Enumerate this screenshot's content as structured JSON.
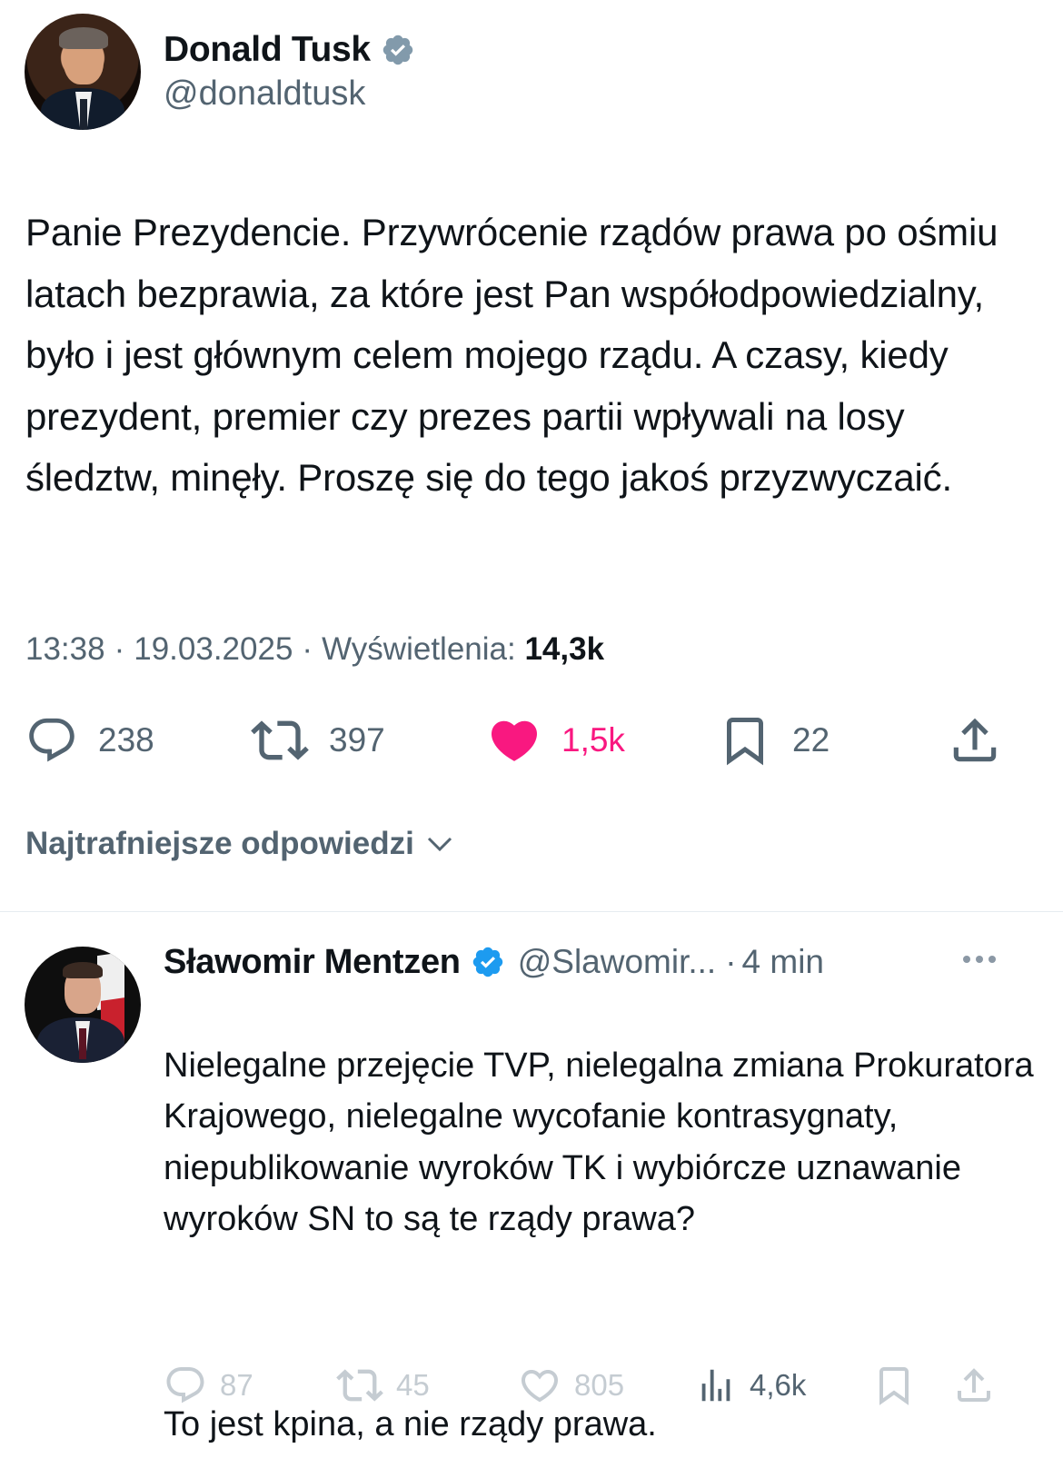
{
  "main_tweet": {
    "author": {
      "name": "Donald Tusk",
      "handle": "@donaldtusk",
      "verified": "gray"
    },
    "text": "Panie Prezydencie. Przywrócenie rządów prawa po ośmiu latach bezprawia, za które jest Pan współodpowiedzialny, było i jest głównym celem mojego rządu. A czasy, kiedy prezydent, premier czy prezes partii wpływali na losy śledztw, minęły. Proszę się do tego jakoś przyzwyczaić.",
    "time": "13:38",
    "date": "19.03.2025",
    "views_label": "Wyświetlenia:",
    "views_count": "14,3k",
    "separator": "·",
    "stats": {
      "replies": "238",
      "reposts": "397",
      "likes": "1,5k",
      "bookmarks": "22"
    },
    "colors": {
      "like": "#f91880",
      "muted": "#536471",
      "text": "#0f1419"
    }
  },
  "replies_sort": {
    "label": "Najtrafniejsze odpowiedzi"
  },
  "reply": {
    "author": {
      "name": "Sławomir Mentzen",
      "handle": "@Slawomir...",
      "verified": "blue"
    },
    "separator": "·",
    "time": "4 min",
    "paragraphs": [
      "Nielegalne przejęcie TVP, nielegalna zmiana Prokuratora Krajowego, nielegalne wycofanie kontrasygnaty, niepublikowanie wyroków TK i wybiórcze uznawanie wyroków SN to są te rządy prawa?",
      "To jest kpina, a nie rządy prawa."
    ],
    "stats": {
      "replies": "87",
      "reposts": "45",
      "likes": "805",
      "views": "4,6k"
    },
    "colors": {
      "verified": "#1d9bf0",
      "faded": "#c5ccd2"
    }
  }
}
